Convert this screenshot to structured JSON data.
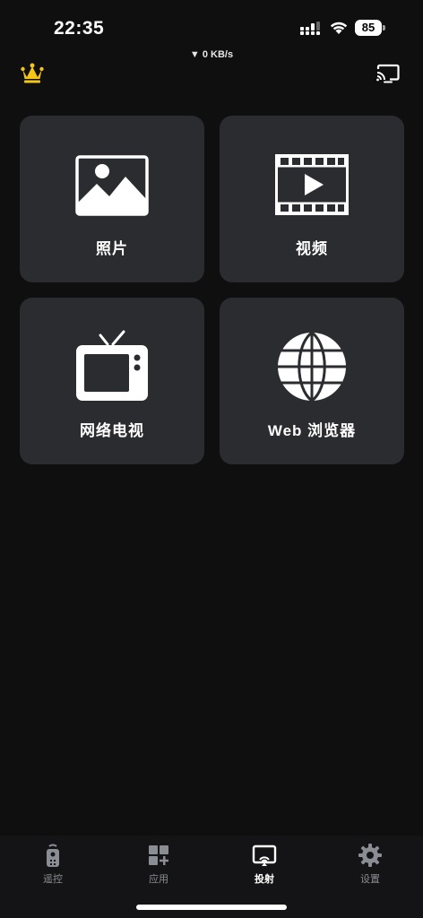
{
  "status_bar": {
    "time": "22:35",
    "battery": "85"
  },
  "header": {
    "net_speed": "▼ 0 KB/s",
    "crown_icon": "crown-icon",
    "cast_icon": "cast-icon"
  },
  "tiles": [
    {
      "label": "照片",
      "icon": "photo-icon"
    },
    {
      "label": "视频",
      "icon": "video-icon"
    },
    {
      "label": "网络电视",
      "icon": "tv-icon"
    },
    {
      "label": "Web 浏览器",
      "icon": "globe-icon"
    }
  ],
  "bottom_nav": {
    "items": [
      {
        "label": "遥控",
        "icon": "remote-icon",
        "active": false
      },
      {
        "label": "应用",
        "icon": "apps-icon",
        "active": false
      },
      {
        "label": "投射",
        "icon": "cast-icon",
        "active": true
      },
      {
        "label": "设置",
        "icon": "gear-icon",
        "active": false
      }
    ]
  },
  "colors": {
    "background": "#0f0f10",
    "tile": "#2b2c30",
    "crown": "#f5c518",
    "inactive_nav": "#8b8d94"
  }
}
